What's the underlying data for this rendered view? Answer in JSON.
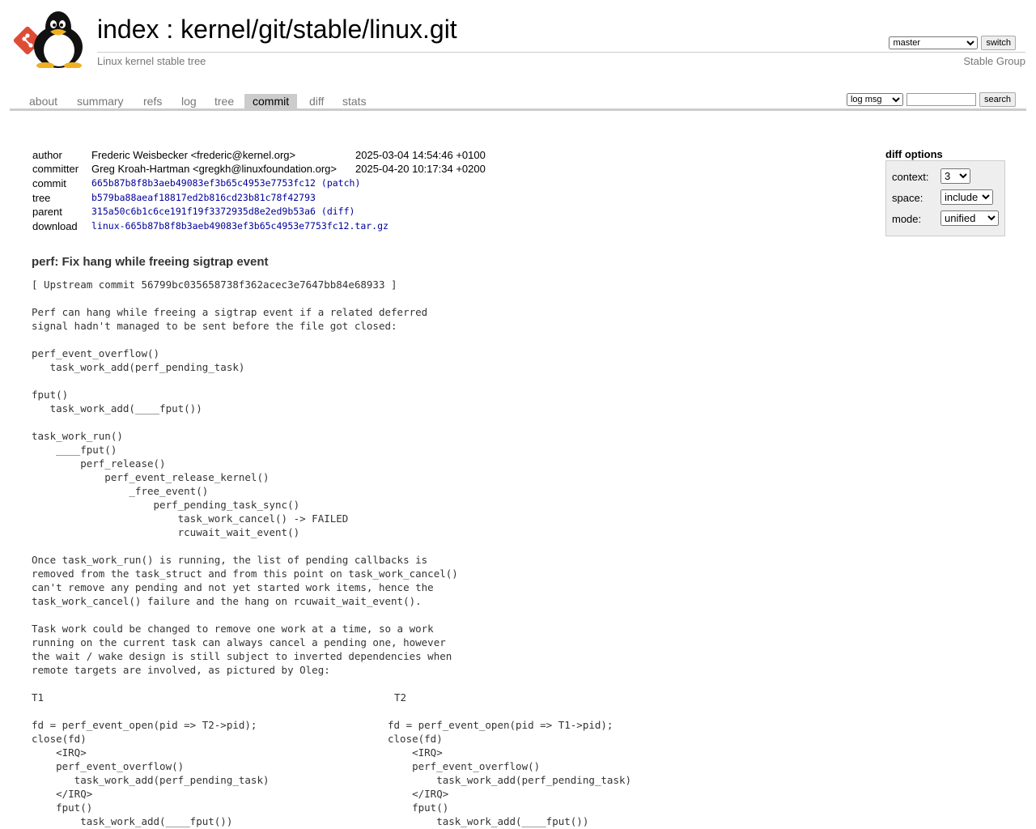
{
  "header": {
    "title_prefix": "index",
    "title_sep": " : ",
    "repo_path": "kernel/git/stable/linux.git",
    "description": "Linux kernel stable tree",
    "owner": "Stable Group",
    "branch_selected": "master",
    "switch_label": "switch"
  },
  "tabs": [
    "about",
    "summary",
    "refs",
    "log",
    "tree",
    "commit",
    "diff",
    "stats"
  ],
  "active_tab": "commit",
  "search": {
    "type_selected": "log msg",
    "query": "",
    "button": "search"
  },
  "commit_info": {
    "author_label": "author",
    "author": "Frederic Weisbecker <frederic@kernel.org>",
    "author_date": "2025-03-04 14:54:46 +0100",
    "committer_label": "committer",
    "committer": "Greg Kroah-Hartman <gregkh@linuxfoundation.org>",
    "committer_date": "2025-04-20 10:17:34 +0200",
    "commit_label": "commit",
    "commit_hash": "665b87b8f8b3aeb49083ef3b65c4953e7753fc12",
    "patch_open": " (",
    "patch_link": "patch",
    "patch_close": ")",
    "tree_label": "tree",
    "tree_hash": "b579ba88aeaf18817ed2b816cd23b81c78f42793",
    "parent_label": "parent",
    "parent_hash": "315a50c6b1c6ce191f19f3372935d8e2ed9b53a6",
    "diff_open": " (",
    "diff_link": "diff",
    "diff_close": ")",
    "download_label": "download",
    "download_file": "linux-665b87b8f8b3aeb49083ef3b65c4953e7753fc12.tar.gz"
  },
  "diff_options": {
    "title": "diff options",
    "context_label": "context:",
    "context_value": "3",
    "space_label": "space:",
    "space_value": "include",
    "mode_label": "mode:",
    "mode_value": "unified"
  },
  "subject": "perf: Fix hang while freeing sigtrap event",
  "message_body": "[ Upstream commit 56799bc035658738f362acec3e7647bb84e68933 ]\n\nPerf can hang while freeing a sigtrap event if a related deferred\nsignal hadn't managed to be sent before the file got closed:\n\nperf_event_overflow()\n   task_work_add(perf_pending_task)\n\nfput()\n   task_work_add(____fput())\n\ntask_work_run()\n    ____fput()\n        perf_release()\n            perf_event_release_kernel()\n                _free_event()\n                    perf_pending_task_sync()\n                        task_work_cancel() -> FAILED\n                        rcuwait_wait_event()\n\nOnce task_work_run() is running, the list of pending callbacks is\nremoved from the task_struct and from this point on task_work_cancel()\ncan't remove any pending and not yet started work items, hence the\ntask_work_cancel() failure and the hang on rcuwait_wait_event().\n\nTask work could be changed to remove one work at a time, so a work\nrunning on the current task can always cancel a pending one, however\nthe wait / wake design is still subject to inverted dependencies when\nremote targets are involved, as pictured by Oleg:\n\nT1\n\nfd = perf_event_open(pid => T2->pid);\nclose(fd)\n    <IRQ>\n    perf_event_overflow()\n       task_work_add(perf_pending_task)\n    </IRQ>\n    fput()\n        task_work_add(____fput())",
  "message_t2_label": "T2",
  "message_t2": "fd = perf_event_open(pid => T1->pid);\nclose(fd)\n    <IRQ>\n    perf_event_overflow()\n        task_work_add(perf_pending_task)\n    </IRQ>\n    fput()\n        task_work_add(____fput())"
}
